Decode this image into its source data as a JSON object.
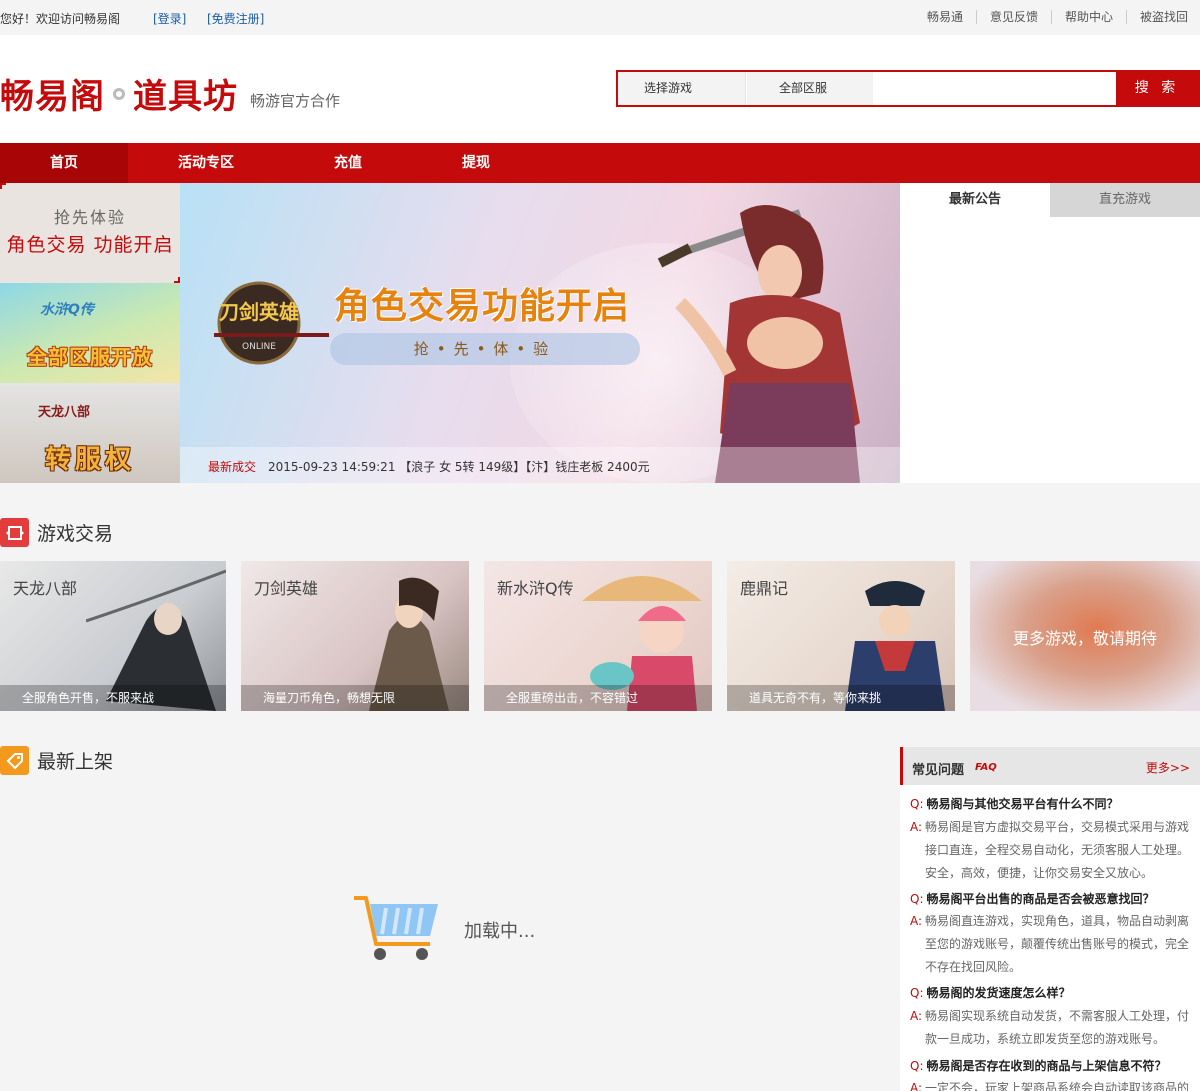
{
  "topbar": {
    "welcome": "您好！欢迎访问畅易阁",
    "login": "[登录]",
    "register": "[免费注册]",
    "links": [
      "畅易通",
      "意见反馈",
      "帮助中心",
      "被盗找回"
    ]
  },
  "header": {
    "logo_part1": "畅易阁",
    "logo_part2": "道具坊",
    "logo_sub": "畅游官方合作",
    "select_game": "选择游戏",
    "select_server": "全部区服",
    "search_value": "",
    "search_button": "搜 索"
  },
  "nav": [
    "首页",
    "活动专区",
    "充值",
    "提现"
  ],
  "side_promos": {
    "p1_line1": "抢先体验",
    "p1_line2": "角色交易  功能开启",
    "p2_logo": "水浒Q传",
    "p2_big": "全部区服开放",
    "p3_logo": "天龙八部",
    "p3_big": "转服权"
  },
  "banner": {
    "logo": "刀剑英雄",
    "headline": "角色交易功能开启",
    "pill": "抢•先•体•验",
    "ticker_label": "最新成交",
    "ticker_text": "2015-09-23 14:59:21 【浪子 女 5转 149级】【汴】钱庄老板 2400元"
  },
  "notice_tabs": [
    "最新公告",
    "直充游戏"
  ],
  "section_games": "游戏交易",
  "games": [
    {
      "name": "天龙八部",
      "caption": "全服角色开售，不服来战"
    },
    {
      "name": "刀剑英雄",
      "caption": "海量刀币角色，畅想无限"
    },
    {
      "name": "新水浒Q传",
      "caption": "全服重磅出击，不容错过"
    },
    {
      "name": "鹿鼎记",
      "caption": "道具无奇不有，等你来挑"
    }
  ],
  "more_games": "更多游戏，敬请期待",
  "section_new": "最新上架",
  "loading": "加载中...",
  "faq": {
    "title": "常见问题",
    "title_en": "FAQ",
    "more": "更多>>",
    "q_mark": "Q:",
    "a_mark": "A:",
    "items": [
      {
        "q": "畅易阁与其他交易平台有什么不同？",
        "a": "畅易阁是官方虚拟交易平台，交易模式采用与游戏接口直连，全程交易自动化，无须客服人工处理。安全，高效，便捷，让你交易安全又放心。"
      },
      {
        "q": "畅易阁平台出售的商品是否会被恶意找回？",
        "a": "畅易阁直连游戏，实现角色，道具，物品自动剥离至您的游戏账号，颠覆传统出售账号的模式，完全不存在找回风险。"
      },
      {
        "q": "畅易阁的发货速度怎么样？",
        "a": "畅易阁实现系统自动发货，不需客服人工处理，付款一旦成功，系统立即发货至您的游戏账号。"
      },
      {
        "q": "畅易阁是否存在收到的商品与上架信息不符？",
        "a": "一定不会，玩家上架商品系统会自动读取该商品的"
      }
    ]
  },
  "colors": {
    "brand_red": "#c40a0a",
    "orange": "#f39a1e"
  }
}
